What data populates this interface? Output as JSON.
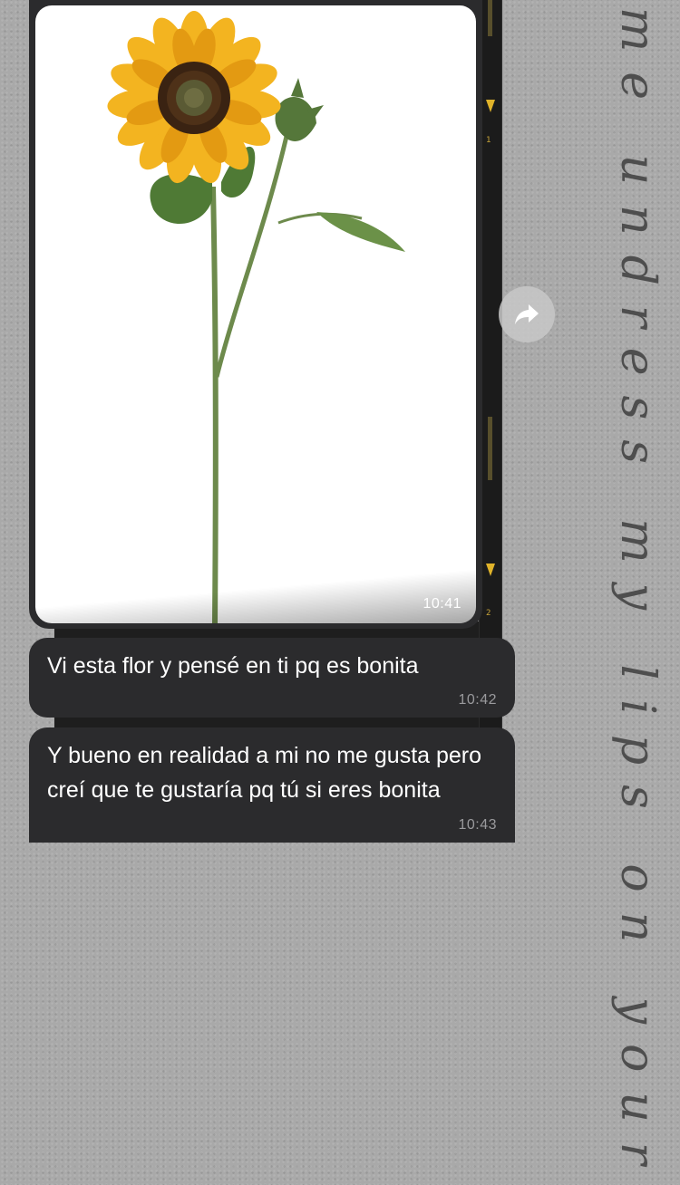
{
  "wallpaper": {
    "background_color": "#a9a9a9",
    "film_accent_color": "#e0b32a",
    "film_numbers": [
      "1",
      "2"
    ],
    "decorative_text": "me undress my lips on your"
  },
  "chat": {
    "bubble_color": "#2b2b2d",
    "messages": [
      {
        "type": "image",
        "image_description": "sunflower",
        "time": "10:41"
      },
      {
        "type": "text",
        "text": "Vi esta flor y pensé en ti pq es bonita",
        "time": "10:42"
      },
      {
        "type": "text",
        "text": "Y bueno en realidad a mi no me gusta pero creí que te gustaría pq tú si eres bonita",
        "time": "10:43"
      }
    ],
    "forward_icon": "forward-arrow-icon"
  }
}
